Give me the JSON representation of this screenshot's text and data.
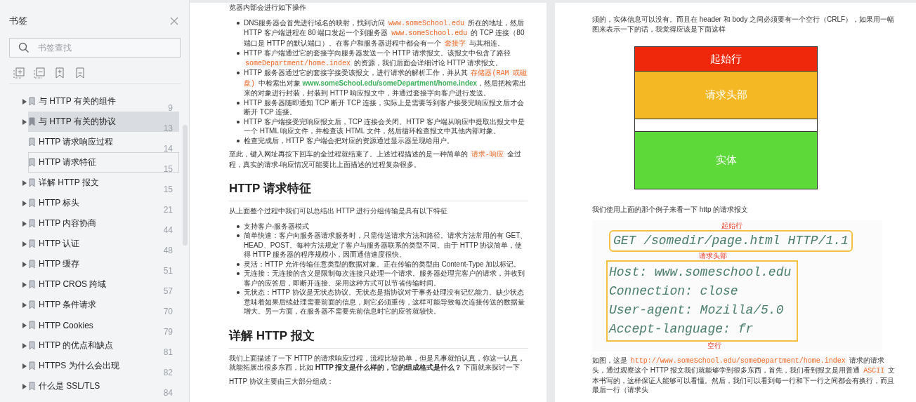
{
  "sidebar": {
    "title": "书签",
    "search": {
      "placeholder": "书签查找"
    },
    "items": [
      {
        "label": "与 HTTP 有关的组件",
        "page": "9",
        "expandable": true,
        "selected": false,
        "focused": false
      },
      {
        "label": "与 HTTP 有关的协议",
        "page": "13",
        "expandable": true,
        "selected": true,
        "focused": false
      },
      {
        "label": "HTTP 请求响应过程",
        "page": "14",
        "expandable": false,
        "selected": false,
        "focused": false
      },
      {
        "label": "HTTP 请求特征",
        "page": "15",
        "expandable": false,
        "selected": false,
        "focused": true
      },
      {
        "label": "详解 HTTP 报文",
        "page": "15",
        "expandable": true,
        "selected": false,
        "focused": false
      },
      {
        "label": "HTTP 标头",
        "page": "21",
        "expandable": true,
        "selected": false,
        "focused": false
      },
      {
        "label": "HTTP 内容协商",
        "page": "44",
        "expandable": true,
        "selected": false,
        "focused": false
      },
      {
        "label": "HTTP 认证",
        "page": "48",
        "expandable": true,
        "selected": false,
        "focused": false
      },
      {
        "label": "HTTP 缓存",
        "page": "51",
        "expandable": true,
        "selected": false,
        "focused": false
      },
      {
        "label": "HTTP CROS 跨域",
        "page": "57",
        "expandable": true,
        "selected": false,
        "focused": false
      },
      {
        "label": "HTTP 条件请求",
        "page": "70",
        "expandable": true,
        "selected": false,
        "focused": false
      },
      {
        "label": "HTTP Cookies",
        "page": "79",
        "expandable": true,
        "selected": false,
        "focused": false
      },
      {
        "label": "HTTP 的优点和缺点",
        "page": "81",
        "expandable": true,
        "selected": false,
        "focused": false
      },
      {
        "label": "HTTPS 为什么会出现",
        "page": "82",
        "expandable": true,
        "selected": false,
        "focused": false
      },
      {
        "label": "什么是 SSL/TLS",
        "page": "84",
        "expandable": true,
        "selected": false,
        "focused": false
      }
    ]
  },
  "left_page": {
    "blocks": [
      {
        "kind": "paragraph",
        "segments": [
          "览器内部会进行如下操作"
        ]
      },
      {
        "kind": "list",
        "items": [
          [
            "DNS服务器会首先进行域名的映射，找到访问 ",
            {
              "text": "www.someSchool.edu",
              "kind": "code"
            },
            " 所在的地址，然后HTTP 客户端进程在 80 端口发起一个到服务器 ",
            {
              "text": "www.someSchool.edu",
              "kind": "code"
            },
            " 的 TCP 连接（80 端口是 HTTP 的默认端口）。在客户和服务器进程中都会有一个 ",
            {
              "text": "套接字",
              "kind": "code"
            },
            " 与其相连。"
          ],
          [
            "HTTP 客户端通过它的套接字向服务器发送一个 HTTP 请求报文。该报文中包含了路径 ",
            {
              "text": "someDepartment/home.index",
              "kind": "code"
            },
            " 的资源，我们后面会详细讨论 HTTP 请求报文。"
          ],
          [
            "HTTP 服务器通过它的套接字接受该报文，进行请求的解析工作，并从其 ",
            {
              "text": "存储器(RAM 或磁盘)",
              "kind": "code"
            },
            " 中检索出对象 ",
            {
              "text": "www.someSchool.edu/someDepartment/home.index",
              "kind": "link"
            },
            "，然后把检索出来的对象进行封装，封装到 HTTP 响应报文中，并通过套接字向客户进行发送。"
          ],
          [
            "HTTP 服务器随即通知 TCP 断开 TCP 连接，实际上是需要等到客户接受完响应报文后才会断开 TCP 连接。"
          ],
          [
            "HTTP 客户端接受完响应报文后，TCP 连接会关闭。HTTP 客户端从响应中提取出报文中是一个 HTML 响应文件，并检查该 HTML 文件，然后循环检查报文中其他内部对象。"
          ],
          [
            "检查完成后，HTTP 客户端会把对应的资源通过显示器呈现给用户。"
          ]
        ]
      },
      {
        "kind": "paragraph",
        "segments": [
          "至此，键入网址再按下回车的全过程就结束了。上述过程描述的是一种简单的 ",
          {
            "text": "请求-响应",
            "kind": "code"
          },
          " 全过程，真实的请求-响应情况可能要比上面描述的过程复杂很多。"
        ]
      },
      {
        "kind": "heading",
        "text": "HTTP 请求特征"
      },
      {
        "kind": "paragraph",
        "segments": [
          "从上面整个过程中我们可以总结出 HTTP 进行分组传输是具有以下特征"
        ]
      },
      {
        "kind": "list",
        "items": [
          [
            "支持客户-服务器模式"
          ],
          [
            "简单快速：客户向服务器请求服务时，只需传送请求方法和路径。请求方法常用的有 GET、HEAD、POST。每种方法规定了客户与服务器联系的类型不同。由于 HTTP 协议简单，使得 HTTP 服务器的程序规模小，因而通信速度很快。"
          ],
          [
            "灵活：HTTP 允许传输任意类型的数据对象。正在传输的类型由 Content-Type 加以标记。"
          ],
          [
            "无连接：无连接的含义是限制每次连接只处理一个请求。服务器处理完客户的请求，并收到客户的应答后，即断开连接。采用这种方式可以节省传输时间。"
          ],
          [
            "无状态：HTTP 协议是无状态协议。无状态是指协议对于事务处理没有记忆能力。缺少状态意味着如果后续处理需要前面的信息，则它必须重传，这样可能导致每次连接传送的数据量增大。另一方面，在服务器不需要先前信息时它的应答就较快。"
          ]
        ]
      },
      {
        "kind": "heading",
        "text": "详解 HTTP 报文"
      },
      {
        "kind": "paragraph",
        "segments": [
          "我们上面描述了一下 HTTP 的请求响应过程，流程比较简单，但是凡事就怕认真，你这一认真，就能拓展出很多东西，比如 ",
          {
            "text": "HTTP 报文是什么样的，它的组成格式是什么？",
            "kind": "bold"
          },
          " 下面就来探讨一下"
        ]
      },
      {
        "kind": "paragraph",
        "segments": [
          "HTTP 协议主要由三大部分组成："
        ]
      }
    ]
  },
  "right_page": {
    "blocks": [
      {
        "kind": "paragraph",
        "segments": [
          "须的，实体信息可以没有。而且在 header 和 body 之间必须要有一个空行（CRLF），如果用一幅图来表示一下的话，我觉得应该是下面这样"
        ]
      },
      {
        "kind": "diagram",
        "rows": [
          {
            "kind": "start",
            "label": "起始行",
            "color": "#ef270b"
          },
          {
            "kind": "header",
            "label": "请求头部",
            "color": "#f4b824"
          },
          {
            "kind": "blank",
            "color": "#ffffff"
          },
          {
            "kind": "body",
            "label": "实体",
            "color": "#5dd93a"
          }
        ]
      },
      {
        "kind": "paragraph",
        "segments": [
          "我们使用上面的那个例子来看一下 http 的请求报文"
        ]
      },
      {
        "kind": "request_figure",
        "start_label": "起始行",
        "start_line": "GET /somedir/page.html HTTP/1.1",
        "header_label": "请求头部",
        "header_lines": [
          "Host: www.someschool.edu",
          "Connection: close",
          "User-agent: Mozilla/5.0",
          "Accept-language: fr"
        ],
        "blank_label": "空行"
      },
      {
        "kind": "paragraph",
        "segments": [
          "如图，这是 ",
          {
            "text": "http://www.someSchool.edu/someDepartment/home.index",
            "kind": "code"
          },
          " 请求的请求头，通过观察这个 HTTP 报文我们就能够学到很多东西，首先，我们看到报文是用普通 ",
          {
            "text": "ASCII",
            "kind": "code"
          },
          " 文本书写的，这样保证人能够可以看懂。然后，我们可以看到每一行和下一行之间都会有换行，而且最后一行（请求头"
        ]
      }
    ]
  }
}
